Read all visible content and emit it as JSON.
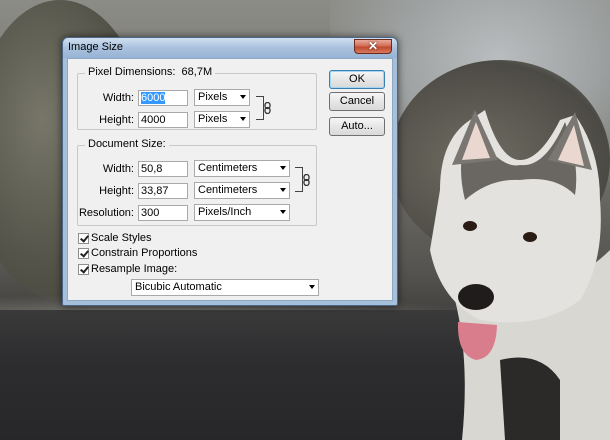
{
  "dialog": {
    "title": "Image Size",
    "close_glyph": "✕",
    "pixel_dimensions": {
      "label": "Pixel Dimensions:",
      "value": "68,7M",
      "width_label": "Width:",
      "width_value": "6000",
      "width_unit": "Pixels",
      "height_label": "Height:",
      "height_value": "4000",
      "height_unit": "Pixels"
    },
    "document_size": {
      "label": "Document Size:",
      "width_label": "Width:",
      "width_value": "50,8",
      "width_unit": "Centimeters",
      "height_label": "Height:",
      "height_value": "33,87",
      "height_unit": "Centimeters",
      "resolution_label": "Resolution:",
      "resolution_value": "300",
      "resolution_unit": "Pixels/Inch"
    },
    "options": {
      "scale_styles": "Scale Styles",
      "constrain_proportions": "Constrain Proportions",
      "resample_image": "Resample Image:",
      "resample_method": "Bicubic Automatic"
    },
    "buttons": {
      "ok": "OK",
      "cancel": "Cancel",
      "auto": "Auto..."
    }
  },
  "icons": [
    "close-icon",
    "link-chain-icon",
    "checkmark-icon",
    "chevron-down-icon"
  ]
}
